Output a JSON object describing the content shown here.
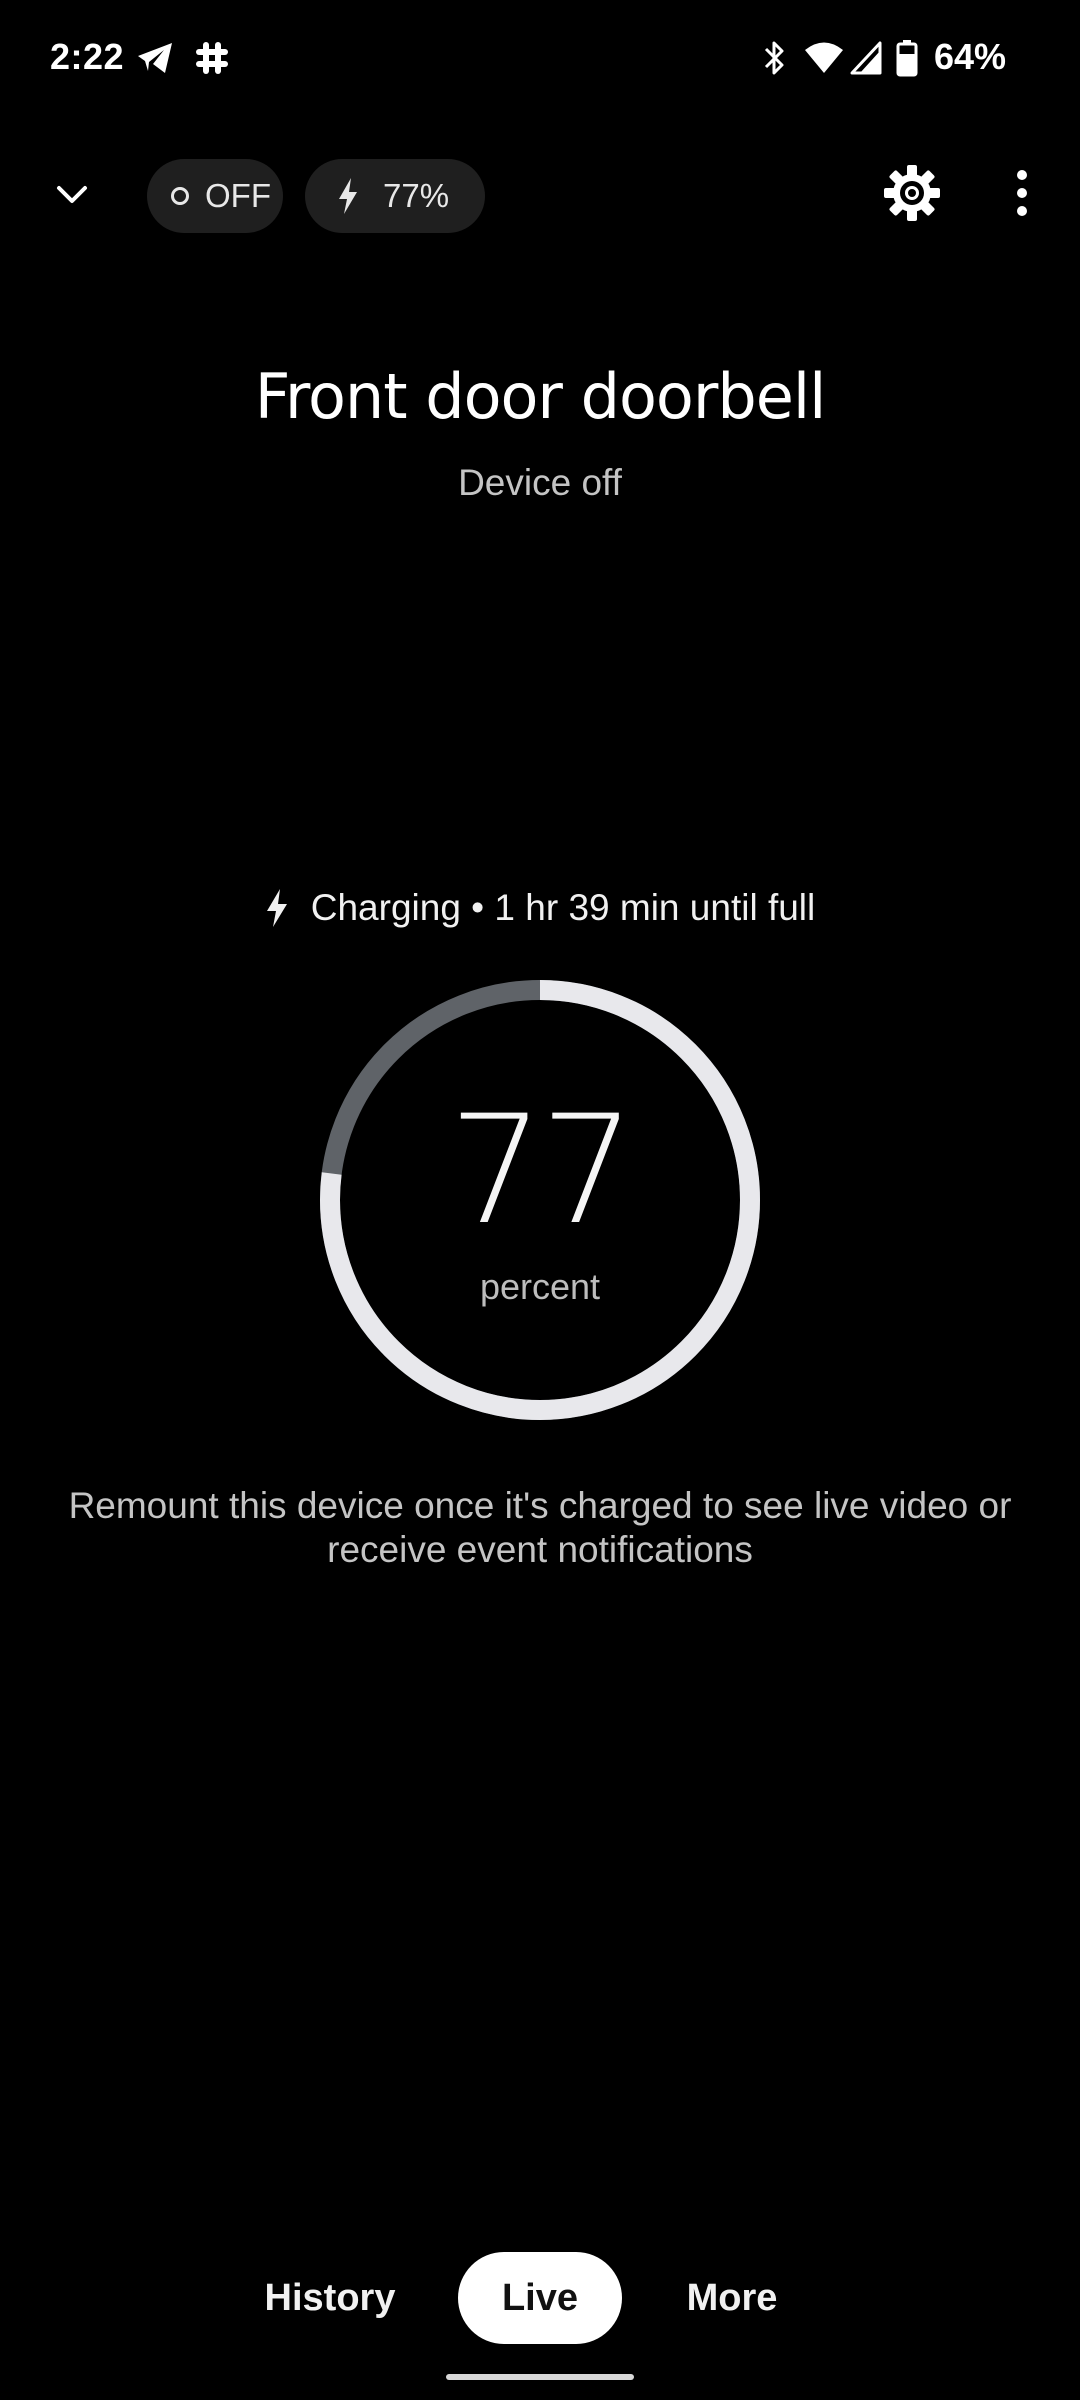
{
  "status_bar": {
    "time": "2:22",
    "battery": "64%",
    "icons": [
      "telegram-icon",
      "slack-icon",
      "bluetooth-icon",
      "wifi-icon",
      "signal-icon",
      "battery-icon"
    ]
  },
  "toolbar": {
    "power_chip_label": "OFF",
    "battery_chip_label": "77%"
  },
  "device": {
    "title": "Front door doorbell",
    "status": "Device off"
  },
  "charging": {
    "label": "Charging • 1 hr 39 min until full",
    "percent_value": "77",
    "percent_unit": "percent",
    "level_fraction": 0.77
  },
  "notice": "Remount this device once it's charged to see live video or receive event notifications",
  "tabs": {
    "history": "History",
    "live": "Live",
    "more": "More",
    "selected": "Live"
  },
  "colors": {
    "background": "#000000",
    "chip_background": "#1f1f1f",
    "gauge_fill": "#e8e8ec",
    "gauge_track": "#5f6368"
  }
}
